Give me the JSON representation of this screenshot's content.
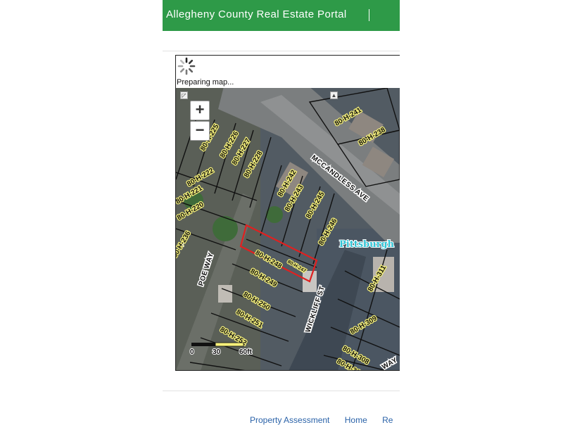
{
  "header": {
    "title": "Allegheny County Real Estate Portal"
  },
  "map": {
    "loading_text": "Preparing map...",
    "zoom_in_label": "+",
    "zoom_out_label": "−",
    "place_label": "Pittsburgh",
    "streets": [
      "MCCANDLESS AVE",
      "POE WAY",
      "WICKLIFF ST",
      "WAY"
    ],
    "parcels": [
      "80-H-241",
      "80-H-238",
      "80-H-225",
      "80-H-226",
      "80-H-227",
      "80-H-228",
      "80-H-222",
      "80-H-221",
      "80-H-220",
      "80-H-242",
      "80-H-243",
      "80-H-245",
      "80-H-246",
      "80-H-248",
      "80-H-247",
      "80-H-249",
      "80-H-250",
      "80-H-251",
      "80-H-252",
      "80-H-236",
      "80-H-309",
      "80-H-308",
      "80-H-307",
      "80-H-311"
    ],
    "scale": {
      "start": "0",
      "mid": "30",
      "end": "60ft"
    },
    "colors": {
      "parcel_line": "#111111",
      "parcel_label_bg": "#f5f07a",
      "selected_parcel": "#e02020",
      "place_label": "#2fc4d6"
    }
  },
  "footer": {
    "links": [
      "Property Assessment",
      "Home",
      "Re"
    ]
  }
}
